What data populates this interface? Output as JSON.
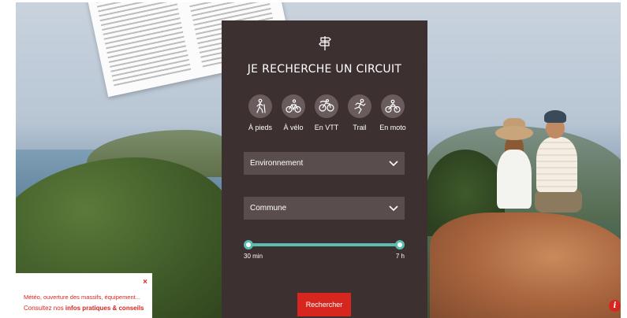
{
  "panel": {
    "title": "JE RECHERCHE UN CIRCUIT",
    "modes": [
      {
        "label": "À pieds",
        "icon": "hiker-icon"
      },
      {
        "label": "À vélo",
        "icon": "bicycle-icon"
      },
      {
        "label": "En VTT",
        "icon": "mountain-bike-icon"
      },
      {
        "label": "Trail",
        "icon": "runner-icon"
      },
      {
        "label": "En moto",
        "icon": "motorbike-icon"
      }
    ],
    "environment_label": "Environnement",
    "commune_label": "Commune",
    "duration": {
      "min": "30 min",
      "max": "7 h",
      "low_fraction": 0,
      "high_fraction": 1
    },
    "search_label": "Rechercher"
  },
  "info_popup": {
    "close": "×",
    "line1": "Météo, ouverture des massifs, équipement...",
    "line2_prefix": "Consultez nos ",
    "line2_bold": "infos pratiques & conseils"
  },
  "info_button": "i",
  "colors": {
    "panel_bg": "#3d3030",
    "accent_red": "#d7261e",
    "slider_teal": "#5bbdb2"
  }
}
